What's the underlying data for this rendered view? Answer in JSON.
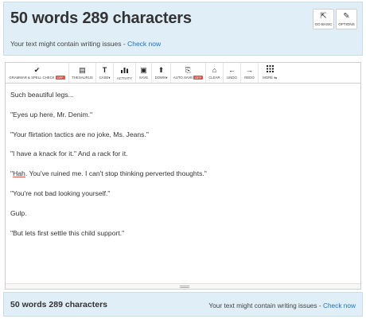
{
  "header": {
    "title": "50 words 289 characters",
    "notice_text": "Your text might contain writing issues - ",
    "notice_link": "Check now",
    "buttons": [
      {
        "label": "Go basic",
        "icon": "external-link-icon",
        "glyph": "⇱"
      },
      {
        "label": "Options",
        "icon": "wrench-icon",
        "glyph": "✎"
      }
    ]
  },
  "toolbar": {
    "items": [
      {
        "label": "Grammar & Spell Check",
        "icon": "check-icon",
        "glyph": "✔",
        "badge": "OFF"
      },
      {
        "label": "Thesaurus",
        "icon": "book-icon",
        "glyph": "▤"
      },
      {
        "label": "Case▾",
        "icon": "text-case-icon",
        "glyph": "T"
      },
      {
        "label": "Activity",
        "icon": "bar-chart-icon",
        "glyph": "▮"
      },
      {
        "label": "Save",
        "icon": "save-icon",
        "glyph": "▣"
      },
      {
        "label": "Down▾",
        "icon": "download-icon",
        "glyph": "⬆"
      },
      {
        "label": "Auto Save",
        "icon": "auto-save-icon",
        "glyph": "⎘",
        "badge": "OFF"
      },
      {
        "label": "Clear",
        "icon": "clear-icon",
        "glyph": "⌂"
      },
      {
        "label": "Undo",
        "icon": "undo-arrow-icon",
        "glyph": "←"
      },
      {
        "label": "Redo",
        "icon": "redo-arrow-icon",
        "glyph": "→"
      },
      {
        "label": "More ⇆",
        "icon": "grid-icon",
        "glyph": "⋮⋮⋮"
      }
    ]
  },
  "editor": {
    "lines": [
      "Such beautiful legs...",
      "\"Eyes up here, Mr. Denim.\"",
      "\"Your flirtation tactics are no joke, Ms. Jeans.\"",
      "\"I have a knack for it.\" And a rack for it.",
      "\"Hah. You've ruined me. I can't stop thinking perverted thoughts.\"",
      "\"You're not bad looking yourself.\"",
      "Gulp.",
      "\"But lets first settle this child support.\""
    ],
    "flagged_word": "Hah"
  },
  "footer": {
    "count": "50 words 289 characters",
    "notice_text": "Your text might contain writing issues - ",
    "notice_link": "Check now"
  }
}
